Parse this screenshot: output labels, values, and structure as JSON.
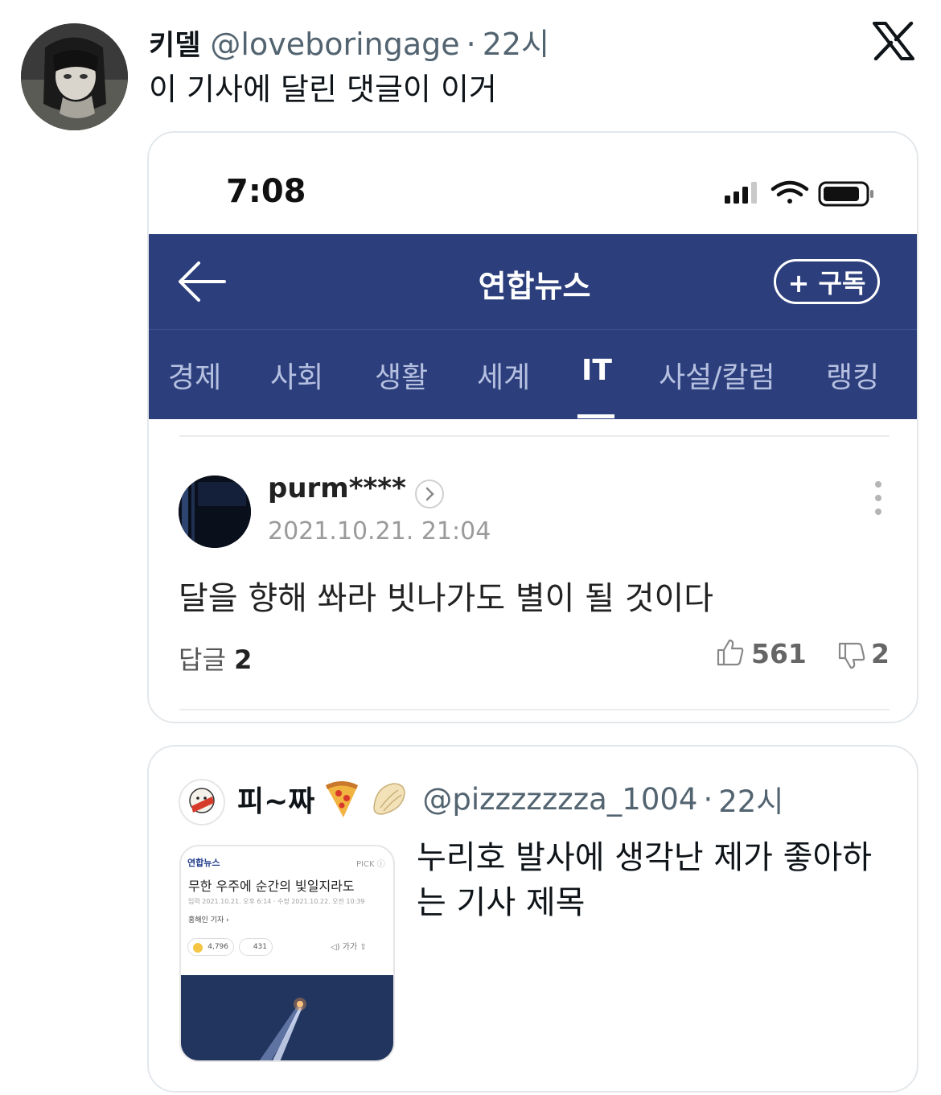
{
  "tweet": {
    "display_name": "키델",
    "handle": "@loveboringage",
    "separator": "·",
    "time": "22시",
    "text": "이 기사에 달린 댓글이 이거"
  },
  "screenshot": {
    "status_time": "7:08",
    "app_title": "연합뉴스",
    "subscribe_label": "+ 구독",
    "tabs": [
      "경제",
      "사회",
      "생활",
      "세계",
      "IT",
      "사설/칼럼",
      "랭킹"
    ],
    "active_tab": "IT",
    "comment": {
      "user": "purm****",
      "date": "2021.10.21. 21:04",
      "body": "달을 향해 쏴라 빗나가도 별이 될 것이다",
      "reply_label": "답글",
      "reply_count": "2",
      "likes": "561",
      "dislikes": "2"
    }
  },
  "quote": {
    "display_name": "피~짜",
    "handle": "@pizzzzzzza_1004",
    "separator": "·",
    "time": "22시",
    "text": "누리호 발사에 생각난 제가 좋아하는 기사 제목",
    "thumbnail": {
      "source": "연합뉴스",
      "badge": "PICK ⓘ",
      "headline": "무한 우주에 순간의 빛일지라도",
      "meta": "입력 2021.10.21. 오후 6:14 · 수정 2021.10.22. 오전 10:39",
      "reporter": "홍해인 기자 ›",
      "reactions": "4,796",
      "comments": "431",
      "tools": "◁)  가가  ⇪"
    }
  },
  "colors": {
    "app_bar": "#2c3f7c",
    "secondary_text": "#536471",
    "primary_text": "#0f1419"
  }
}
